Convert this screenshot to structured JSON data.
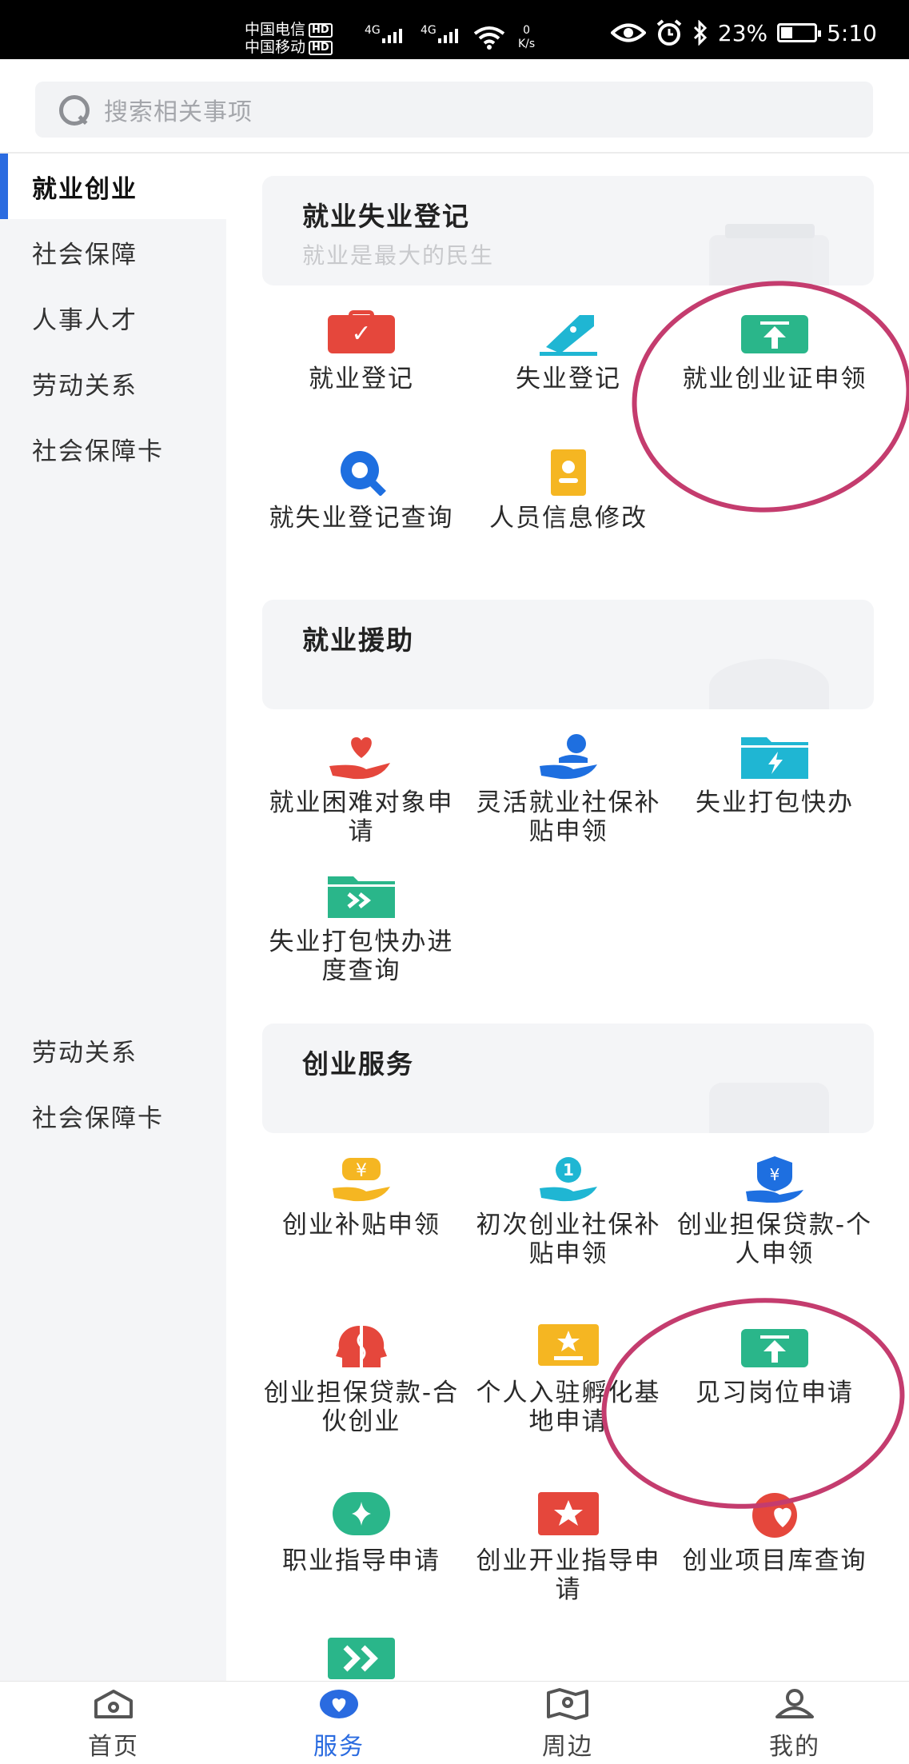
{
  "status_bar": {
    "carrier1": "中国电信",
    "carrier2": "中国移动",
    "hd": "HD",
    "network": "4G",
    "speed_value": "0",
    "speed_unit": "K/s",
    "battery": "23%",
    "time": "5:10"
  },
  "search": {
    "placeholder": "搜索相关事项"
  },
  "sidebar": {
    "items": [
      "就业创业",
      "社会保障",
      "人事人才",
      "劳动关系",
      "社会保障卡"
    ],
    "repeat_items": [
      "劳动关系",
      "社会保障卡"
    ]
  },
  "sections": [
    {
      "title": "就业失业登记",
      "subtitle": "就业是最大的民生",
      "tiles": [
        {
          "label": "就业登记",
          "icon": "briefcase-check-icon",
          "color": "#e5473c"
        },
        {
          "label": "失业登记",
          "icon": "pen-icon",
          "color": "#1fb6d3"
        },
        {
          "label": "就业创业证申领",
          "icon": "upload-arrow-icon",
          "color": "#2ab68a"
        },
        {
          "label": "就失业登记查询",
          "icon": "magnifier-icon",
          "color": "#1e6fe0"
        },
        {
          "label": "人员信息修改",
          "icon": "id-card-icon",
          "color": "#f5b622"
        }
      ]
    },
    {
      "title": "就业援助",
      "subtitle": "",
      "tiles": [
        {
          "label": "就业困难对象申请",
          "icon": "heart-hand-icon",
          "color": "#e5473c"
        },
        {
          "label": "灵活就业社保补贴申领",
          "icon": "person-hand-icon",
          "color": "#1e6fe0"
        },
        {
          "label": "失业打包快办",
          "icon": "folder-lightning-icon",
          "color": "#1fb6d3"
        },
        {
          "label": "失业打包快办进度查询",
          "icon": "folder-forward-icon",
          "color": "#2ab68a"
        }
      ]
    },
    {
      "title": "创业服务",
      "subtitle": "",
      "tiles": [
        {
          "label": "创业补贴申领",
          "icon": "yen-hand-icon",
          "color": "#f5b622"
        },
        {
          "label": "初次创业社保补贴申领",
          "icon": "first-hand-icon",
          "color": "#1fb6d3"
        },
        {
          "label": "创业担保贷款-个人申领",
          "icon": "yen-shield-icon",
          "color": "#1e6fe0"
        },
        {
          "label": "创业担保贷款-合伙创业",
          "icon": "partner-head-icon",
          "color": "#e5473c"
        },
        {
          "label": "个人入驻孵化基地申请",
          "icon": "star-board-icon",
          "color": "#f5b622"
        },
        {
          "label": "见习岗位申请",
          "icon": "upload-arrow-icon",
          "color": "#2ab68a"
        },
        {
          "label": "职业指导申请",
          "icon": "sparkle-circle-icon",
          "color": "#2ab68a"
        },
        {
          "label": "创业开业指导申请",
          "icon": "star-flag-icon",
          "color": "#e5473c"
        },
        {
          "label": "创业项目库查询",
          "icon": "heart-circle-icon",
          "color": "#e5473c"
        },
        {
          "label": "",
          "icon": "double-arrow-icon",
          "color": "#2ab68a"
        }
      ]
    }
  ],
  "bottom_nav": [
    {
      "label": "首页",
      "icon": "home-icon"
    },
    {
      "label": "服务",
      "icon": "heart-service-icon"
    },
    {
      "label": "周边",
      "icon": "map-icon"
    },
    {
      "label": "我的",
      "icon": "user-icon"
    }
  ],
  "colors": {
    "accent": "#2a6be0",
    "annotation": "#c43c6e"
  }
}
